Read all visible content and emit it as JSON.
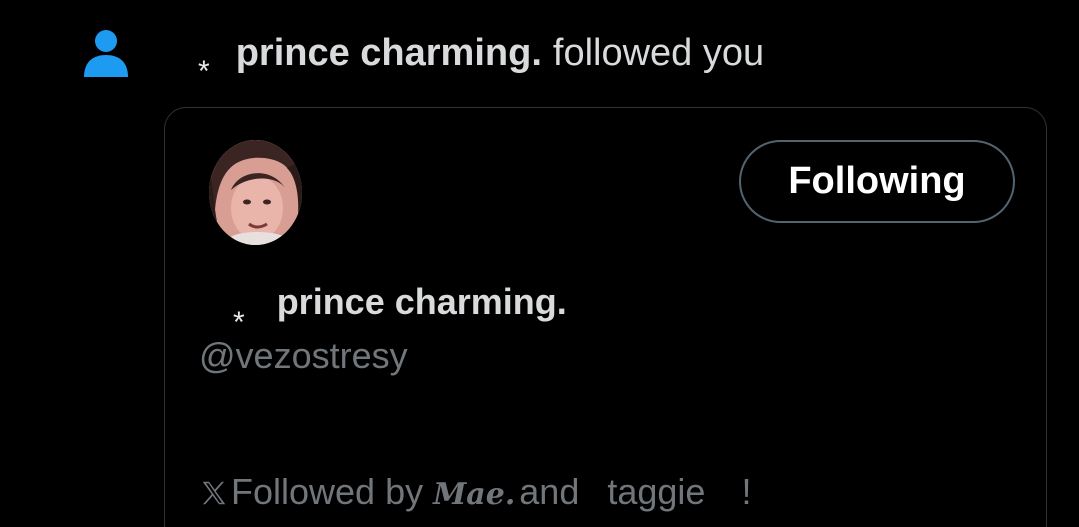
{
  "notification": {
    "icon": "person-icon",
    "accent_color": "#1d9bf0",
    "star": "*",
    "display_name": "prince charming.",
    "action_text": "followed you"
  },
  "profile_card": {
    "avatar": "profile-photo",
    "follow_button_label": "Following",
    "star": "*",
    "display_name": "prince charming.",
    "handle": "@vezostresy",
    "followed_by": {
      "prefix": "Followed by",
      "name1": "Mae.",
      "conjunction": "and",
      "name2": "taggie",
      "suffix": "!"
    }
  }
}
